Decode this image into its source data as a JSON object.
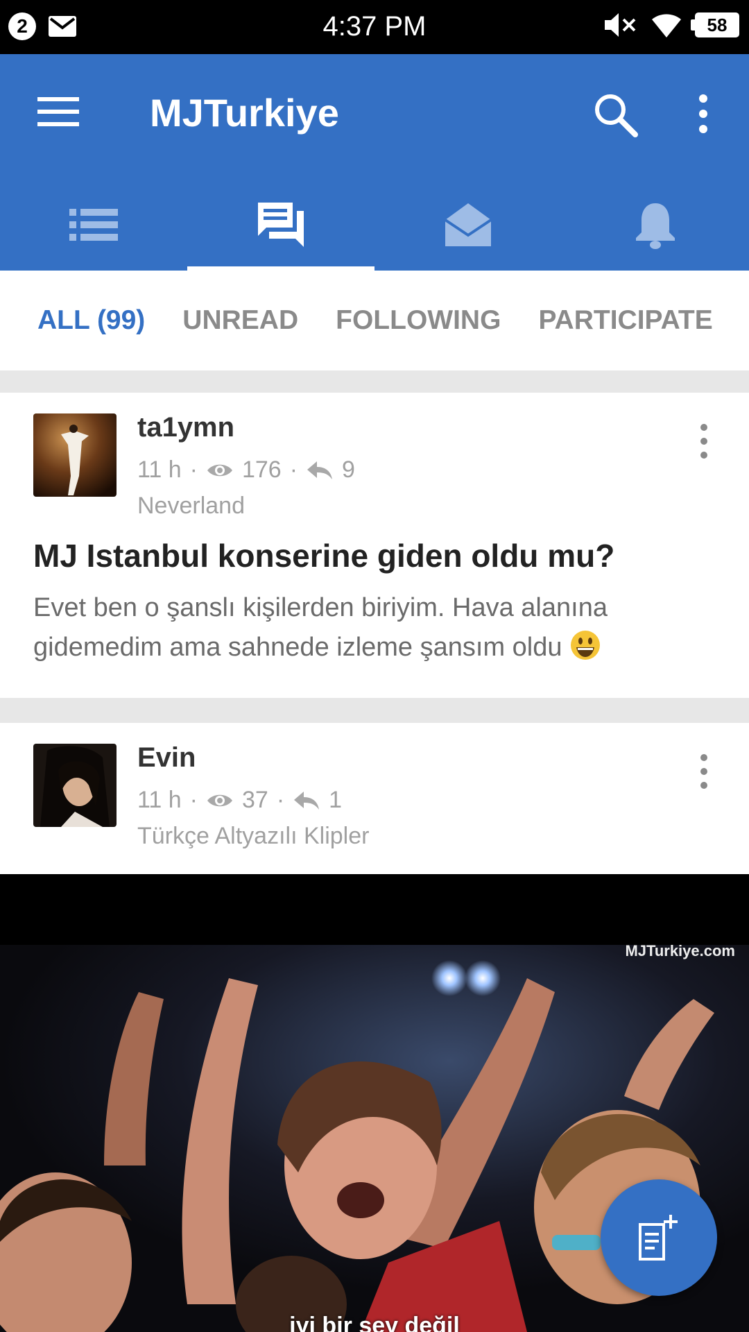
{
  "status_bar": {
    "notification_count": "2",
    "time": "4:37 PM",
    "battery": "58",
    "icons": [
      "mail-icon",
      "mute-icon",
      "wifi-icon",
      "battery-icon"
    ]
  },
  "app_bar": {
    "title": "MJTurkiye",
    "color": "#3470c4",
    "tabs": [
      {
        "icon": "list-icon"
      },
      {
        "icon": "forum-icon",
        "active": true
      },
      {
        "icon": "inbox-icon"
      },
      {
        "icon": "bell-icon"
      }
    ]
  },
  "filters": {
    "all": "ALL (99)",
    "unread": "UNREAD",
    "following": "FOLLOWING",
    "participate": "PARTICIPATE"
  },
  "posts": [
    {
      "author": "ta1ymn",
      "time": "11 h",
      "views": "176",
      "replies": "9",
      "forum": "Neverland",
      "title": "MJ Istanbul konserine giden oldu mu?",
      "body": "Evet ben o şanslı kişilerden biriyim. Hava alanına gidemedim ama sahnede izleme şansım oldu"
    },
    {
      "author": "Evin",
      "time": "11 h",
      "views": "37",
      "replies": "1",
      "forum": "Türkçe Altyazılı Klipler"
    }
  ],
  "media": {
    "watermark": "MJTurkiye.com",
    "caption": "iyi bir şey değil"
  }
}
